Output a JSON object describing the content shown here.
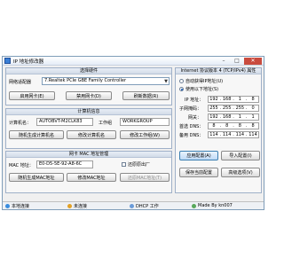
{
  "window": {
    "title": "IP 地址修改器",
    "min": "–",
    "max": "□",
    "close": "✕"
  },
  "adapter": {
    "heading": "选择硬件",
    "label": "网络适配器",
    "selected": "7.Realtek PCIe GBE Family Controller",
    "enable_btn": "启用网卡(E)",
    "disable_btn": "禁用网卡(D)",
    "refresh_btn": "刷新数据(R)"
  },
  "computer": {
    "heading": "计算机信息",
    "name_label": "计算机名：",
    "name_value": "AUTOBVT-M2CLK83",
    "wg_label": "工作组",
    "wg_value": "WORKGROUP",
    "random_btn": "随机生成计算机名",
    "modify_name_btn": "修改计算机名",
    "modify_wg_btn": "修改工作组(W)"
  },
  "mac": {
    "heading": "网卡 MAC 地址管理",
    "label": "MAC 地址：",
    "value": "E0-D5-5E-92-A8-6C",
    "check": "",
    "restore_label": "还原原出厂",
    "random_btn": "随机生成MAC地址",
    "modify_btn": "修改MAC地址",
    "restore_btn": "还原MAC地址(T)"
  },
  "ipv4": {
    "heading": "Internet 协议版本 4 (TCP/IPv4) 属性",
    "auto_label": "自动获得IP地址(U)",
    "manual_label": "使用以下地址(S)",
    "rows": [
      {
        "label": "IP 地址：",
        "octets": [
          "192",
          "168",
          "1",
          "8"
        ]
      },
      {
        "label": "子网掩码：",
        "octets": [
          "255",
          "255",
          "255",
          "0"
        ]
      },
      {
        "label": "网关：",
        "octets": [
          "192",
          "168",
          "1",
          "1"
        ]
      },
      {
        "label": "首选 DNS：",
        "octets": [
          "8",
          "8",
          "8",
          "8"
        ]
      },
      {
        "label": "备用 DNS：",
        "octets": [
          "114",
          "114",
          "114",
          "114"
        ]
      }
    ],
    "apply_btn": "应用配置(A)",
    "import_btn": "导入配置(I)",
    "save_btn": "保存当前配置",
    "advanced_btn": "高级选项(V)"
  },
  "status": {
    "s1": "本地连接",
    "s2": "未连接",
    "s3": "DHCP 工作",
    "s4": "Made By kn007"
  }
}
